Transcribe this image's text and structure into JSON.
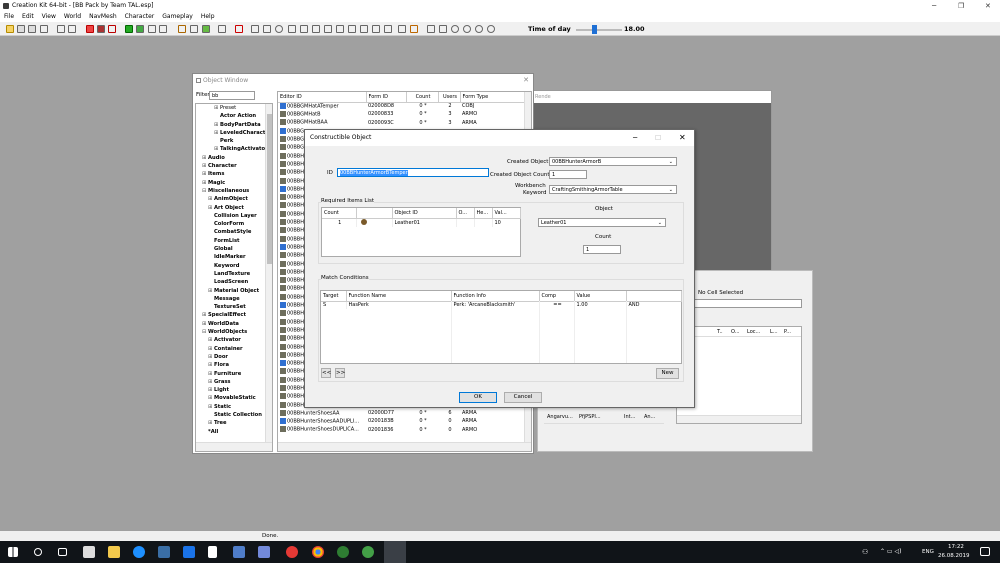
{
  "app": {
    "title": "Creation Kit 64-bit - [BB Pack by Team TAL.esp]",
    "menu": [
      "File",
      "Edit",
      "View",
      "World",
      "NavMesh",
      "Character",
      "Gameplay",
      "Help"
    ],
    "time_of_day_label": "Time of day",
    "time_of_day_value": "18.00",
    "time_of_day_fraction": 0.4,
    "status": "Done."
  },
  "object_window": {
    "title": "Object Window",
    "filter_label": "Filter",
    "filter_value": "bb",
    "tree": [
      {
        "label": "Preset",
        "prefix": "⊞",
        "indent": 3,
        "bold": false
      },
      {
        "label": "Actor Action",
        "prefix": "",
        "indent": 3,
        "bold": true
      },
      {
        "label": "BodyPartData",
        "prefix": "⊞",
        "indent": 3,
        "bold": true
      },
      {
        "label": "LeveledCharacter",
        "prefix": "⊞",
        "indent": 3,
        "bold": true
      },
      {
        "label": "Perk",
        "prefix": "",
        "indent": 3,
        "bold": true
      },
      {
        "label": "TalkingActivator",
        "prefix": "⊞",
        "indent": 3,
        "bold": true
      },
      {
        "label": "Audio",
        "prefix": "⊞",
        "indent": 1,
        "bold": true
      },
      {
        "label": "Character",
        "prefix": "⊞",
        "indent": 1,
        "bold": true
      },
      {
        "label": "Items",
        "prefix": "⊞",
        "indent": 1,
        "bold": true
      },
      {
        "label": "Magic",
        "prefix": "⊞",
        "indent": 1,
        "bold": true
      },
      {
        "label": "Miscellaneous",
        "prefix": "⊟",
        "indent": 1,
        "bold": true
      },
      {
        "label": "AnimObject",
        "prefix": "⊞",
        "indent": 2,
        "bold": true
      },
      {
        "label": "Art Object",
        "prefix": "⊞",
        "indent": 2,
        "bold": true
      },
      {
        "label": "Collision Layer",
        "prefix": "",
        "indent": 2,
        "bold": true
      },
      {
        "label": "ColorForm",
        "prefix": "",
        "indent": 2,
        "bold": true
      },
      {
        "label": "CombatStyle",
        "prefix": "",
        "indent": 2,
        "bold": true
      },
      {
        "label": "FormList",
        "prefix": "",
        "indent": 2,
        "bold": true
      },
      {
        "label": "Global",
        "prefix": "",
        "indent": 2,
        "bold": true
      },
      {
        "label": "IdleMarker",
        "prefix": "",
        "indent": 2,
        "bold": true
      },
      {
        "label": "Keyword",
        "prefix": "",
        "indent": 2,
        "bold": true
      },
      {
        "label": "LandTexture",
        "prefix": "",
        "indent": 2,
        "bold": true
      },
      {
        "label": "LoadScreen",
        "prefix": "",
        "indent": 2,
        "bold": true
      },
      {
        "label": "Material Object",
        "prefix": "⊞",
        "indent": 2,
        "bold": true
      },
      {
        "label": "Message",
        "prefix": "",
        "indent": 2,
        "bold": true
      },
      {
        "label": "TextureSet",
        "prefix": "",
        "indent": 2,
        "bold": true
      },
      {
        "label": "SpecialEffect",
        "prefix": "⊞",
        "indent": 1,
        "bold": true
      },
      {
        "label": "WorldData",
        "prefix": "⊞",
        "indent": 1,
        "bold": true
      },
      {
        "label": "WorldObjects",
        "prefix": "⊟",
        "indent": 1,
        "bold": true
      },
      {
        "label": "Activator",
        "prefix": "⊞",
        "indent": 2,
        "bold": true
      },
      {
        "label": "Container",
        "prefix": "⊞",
        "indent": 2,
        "bold": true
      },
      {
        "label": "Door",
        "prefix": "⊞",
        "indent": 2,
        "bold": true
      },
      {
        "label": "Flora",
        "prefix": "⊞",
        "indent": 2,
        "bold": true
      },
      {
        "label": "Furniture",
        "prefix": "⊞",
        "indent": 2,
        "bold": true
      },
      {
        "label": "Grass",
        "prefix": "⊞",
        "indent": 2,
        "bold": true
      },
      {
        "label": "Light",
        "prefix": "⊞",
        "indent": 2,
        "bold": true
      },
      {
        "label": "MovableStatic",
        "prefix": "⊞",
        "indent": 2,
        "bold": true
      },
      {
        "label": "Static",
        "prefix": "⊞",
        "indent": 2,
        "bold": true
      },
      {
        "label": "Static Collection",
        "prefix": "",
        "indent": 2,
        "bold": true
      },
      {
        "label": "Tree",
        "prefix": "⊞",
        "indent": 2,
        "bold": true
      },
      {
        "label": "*All",
        "prefix": "",
        "indent": 1,
        "bold": true
      }
    ],
    "columns": [
      "Editor ID",
      "Form ID",
      "Count",
      "Users",
      "Form Type"
    ],
    "rows": [
      {
        "id": "00BBGMHatATemper",
        "form": "020008D8",
        "count": "0 *",
        "users": "2",
        "type": "COBJ"
      },
      {
        "id": "00BBGMHatB",
        "form": "02000833",
        "count": "0 *",
        "users": "3",
        "type": "ARMO"
      },
      {
        "id": "00BBGMHatBAA",
        "form": "0200093C",
        "count": "0 *",
        "users": "3",
        "type": "ARMA"
      },
      {
        "id": "00BBG",
        "form": "",
        "count": "",
        "users": "",
        "type": ""
      },
      {
        "id": "00BBG",
        "form": "",
        "count": "",
        "users": "",
        "type": ""
      },
      {
        "id": "00BBG",
        "form": "",
        "count": "",
        "users": "",
        "type": ""
      },
      {
        "id": "00BBH",
        "form": "",
        "count": "",
        "users": "",
        "type": ""
      },
      {
        "id": "00BBH",
        "form": "",
        "count": "",
        "users": "",
        "type": ""
      },
      {
        "id": "00BBH",
        "form": "",
        "count": "",
        "users": "",
        "type": ""
      },
      {
        "id": "00BBH",
        "form": "",
        "count": "",
        "users": "",
        "type": ""
      },
      {
        "id": "00BBH",
        "form": "",
        "count": "",
        "users": "",
        "type": ""
      },
      {
        "id": "00BBH",
        "form": "",
        "count": "",
        "users": "",
        "type": ""
      },
      {
        "id": "00BBH",
        "form": "",
        "count": "",
        "users": "",
        "type": ""
      },
      {
        "id": "00BBH",
        "form": "",
        "count": "",
        "users": "",
        "type": ""
      },
      {
        "id": "00BBH",
        "form": "",
        "count": "",
        "users": "",
        "type": ""
      },
      {
        "id": "00BBH",
        "form": "",
        "count": "",
        "users": "",
        "type": ""
      },
      {
        "id": "00BBH",
        "form": "",
        "count": "",
        "users": "",
        "type": ""
      },
      {
        "id": "00BBH",
        "form": "",
        "count": "",
        "users": "",
        "type": ""
      },
      {
        "id": "00BBH",
        "form": "",
        "count": "",
        "users": "",
        "type": ""
      },
      {
        "id": "00BBH",
        "form": "",
        "count": "",
        "users": "",
        "type": ""
      },
      {
        "id": "00BBH",
        "form": "",
        "count": "",
        "users": "",
        "type": ""
      },
      {
        "id": "00BBH",
        "form": "",
        "count": "",
        "users": "",
        "type": ""
      },
      {
        "id": "00BBH",
        "form": "",
        "count": "",
        "users": "",
        "type": ""
      },
      {
        "id": "00BBH",
        "form": "",
        "count": "",
        "users": "",
        "type": ""
      },
      {
        "id": "00BBH",
        "form": "",
        "count": "",
        "users": "",
        "type": ""
      },
      {
        "id": "00BBH",
        "form": "",
        "count": "",
        "users": "",
        "type": ""
      },
      {
        "id": "00BBH",
        "form": "",
        "count": "",
        "users": "",
        "type": ""
      },
      {
        "id": "00BBH",
        "form": "",
        "count": "",
        "users": "",
        "type": ""
      },
      {
        "id": "00BBH",
        "form": "",
        "count": "",
        "users": "",
        "type": ""
      },
      {
        "id": "00BBH",
        "form": "",
        "count": "",
        "users": "",
        "type": ""
      },
      {
        "id": "00BBH",
        "form": "",
        "count": "",
        "users": "",
        "type": ""
      },
      {
        "id": "00BBH",
        "form": "",
        "count": "",
        "users": "",
        "type": ""
      },
      {
        "id": "00BBH",
        "form": "",
        "count": "",
        "users": "",
        "type": ""
      },
      {
        "id": "00BBH",
        "form": "",
        "count": "",
        "users": "",
        "type": ""
      },
      {
        "id": "00BBH",
        "form": "",
        "count": "",
        "users": "",
        "type": ""
      },
      {
        "id": "00BBH",
        "form": "",
        "count": "",
        "users": "",
        "type": ""
      },
      {
        "id": "00BBHunterShoes",
        "form": "02000D78",
        "count": "0 *",
        "users": "4",
        "type": "ARMO"
      },
      {
        "id": "00BBHunterShoesAA",
        "form": "02000D77",
        "count": "0 *",
        "users": "6",
        "type": "ARMA"
      },
      {
        "id": "00BBHunterShoesAADUPLI...",
        "form": "0200183B",
        "count": "0 *",
        "users": "0",
        "type": "ARMA"
      },
      {
        "id": "00BBHunterShoesDUPLICA...",
        "form": "02001836",
        "count": "0 *",
        "users": "0",
        "type": "ARMO"
      }
    ]
  },
  "cell_window": {
    "header": "No Cell Selected",
    "columns": [
      "T..",
      "O...",
      "Loc...",
      "L...",
      "P...",
      "R"
    ],
    "left_row": [
      "Angarvu...",
      "PfjPSPI...",
      "Int...",
      "An..."
    ]
  },
  "render_window": {
    "title": "Rende"
  },
  "dialog": {
    "title": "Constructible Object",
    "id_label": "ID",
    "id_value": "00BBHunterArmorBTemper",
    "created_object_label": "Created Object",
    "created_object_value": "00BBHunterArmorB",
    "created_count_label": "Created Object Count",
    "created_count_value": "1",
    "workbench_label_1": "Workbench",
    "workbench_label_2": "Keyword",
    "workbench_value": "CraftingSmithingArmorTable",
    "required_label": "Required Items List",
    "req_columns": [
      "Count",
      "",
      "Object ID",
      "O...",
      "He...",
      "Val..."
    ],
    "req_row": {
      "count": "1",
      "object": "Leather01",
      "val": "10"
    },
    "object_label": "Object",
    "object_value": "Leather01",
    "count_label": "Count",
    "count_value": "1",
    "match_label": "Match Conditions",
    "cond_columns": [
      "Target",
      "Function Name",
      "Function Info",
      "Comp",
      "Value",
      ""
    ],
    "cond_row": {
      "target": "S",
      "func": "HasPerk",
      "info": "Perk: 'ArcaneBlacksmith'",
      "comp": "==",
      "value": "1.00",
      "op": "AND"
    },
    "prev_btn": "<<",
    "next_btn": ">>",
    "new_btn": "New",
    "ok_btn": "OK",
    "cancel_btn": "Cancel"
  },
  "taskbar": {
    "lang": "ENG",
    "time": "17:22",
    "date": "26.08.2019"
  }
}
